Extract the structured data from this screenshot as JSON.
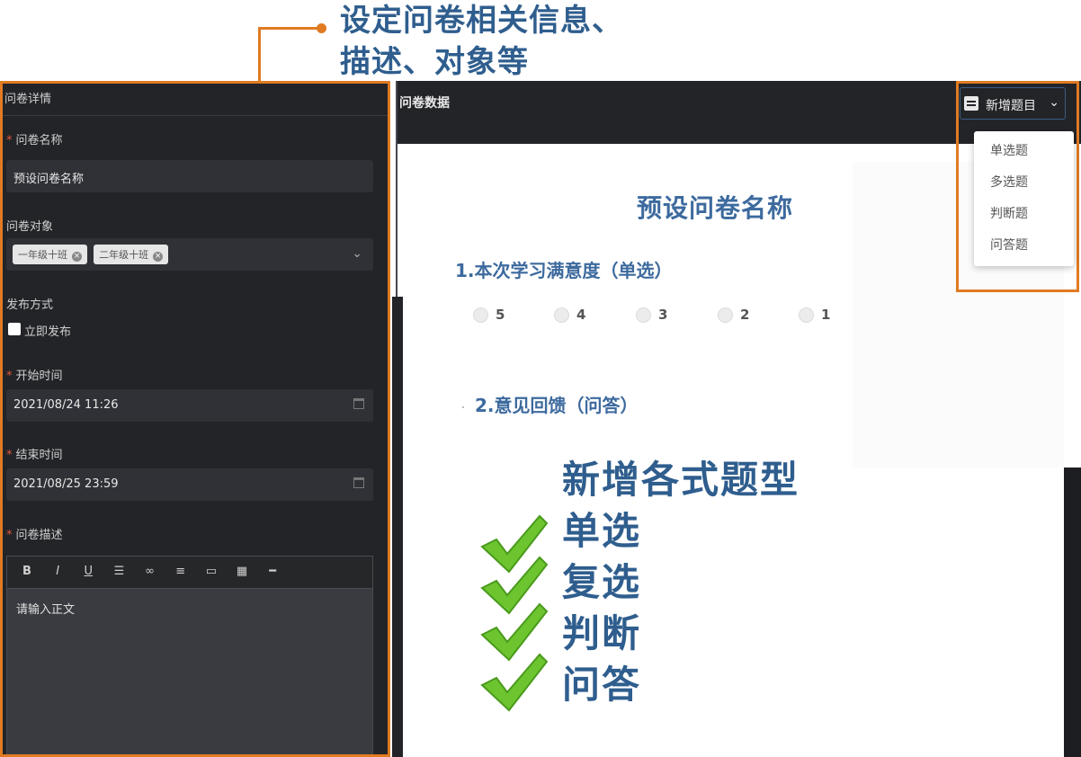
{
  "annotation": {
    "title_line1": "设定问卷相关信息、",
    "title_line2": "描述、对象等",
    "accent_color": "#e07b22"
  },
  "left_panel": {
    "header": "问卷详情",
    "name_label": "问卷名称",
    "name_value": "预设问卷名称",
    "target_label": "问卷对象",
    "target_tags": [
      "一年级十班",
      "二年级十班"
    ],
    "publish_label": "发布方式",
    "publish_option": "立即发布",
    "start_label": "开始时间",
    "start_value": "2021/08/24 11:26",
    "end_label": "结束时间",
    "end_value": "2021/08/25 23:59",
    "desc_label": "问卷描述",
    "editor_tools": [
      "B",
      "I",
      "U",
      "indent-icon",
      "link-icon",
      "list-icon",
      "image-icon",
      "table-icon",
      "hr-icon"
    ],
    "editor_placeholder": "请输入正文"
  },
  "right_panel": {
    "header": "问卷数据",
    "add_button": "新增题目",
    "menu_items": [
      "单选题",
      "多选题",
      "判断题",
      "问答题"
    ],
    "survey_title": "预设问卷名称",
    "question1": "1.本次学习满意度（单选）",
    "question1_options": [
      "5",
      "4",
      "3",
      "2",
      "1"
    ],
    "question2": "2.意见回馈（问答）"
  },
  "features": {
    "heading": "新增各式题型",
    "items": [
      "单选",
      "复选",
      "判断",
      "问答"
    ]
  }
}
